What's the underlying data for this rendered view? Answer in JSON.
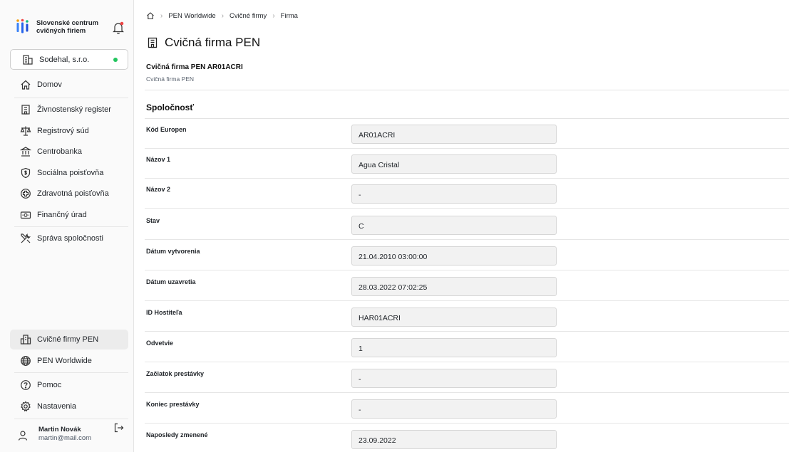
{
  "brand": {
    "name_line1": "Slovenské centrum",
    "name_line2": "cvičných firiem"
  },
  "org_switcher": {
    "label": "Sodehal, s.r.o.",
    "status_color": "#22c55e"
  },
  "nav_top": [
    {
      "label": "Domov",
      "icon": "home-icon"
    },
    {
      "label": "Živnostenský register",
      "icon": "building-icon"
    },
    {
      "label": "Registrový súd",
      "icon": "court-icon"
    },
    {
      "label": "Centrobanka",
      "icon": "bank-icon"
    },
    {
      "label": "Sociálna poisťovňa",
      "icon": "shield-dollar-icon"
    },
    {
      "label": "Zdravotná poisťovňa",
      "icon": "health-cross-icon"
    },
    {
      "label": "Finančný úrad",
      "icon": "cash-icon"
    },
    {
      "label": "Správa spoločnosti",
      "icon": "tools-icon"
    }
  ],
  "nav_bottom": [
    {
      "label": "Cvičné firmy PEN",
      "icon": "companies-icon",
      "active": true
    },
    {
      "label": "PEN Worldwide",
      "icon": "globe-icon"
    },
    {
      "label": "Pomoc",
      "icon": "help-icon"
    },
    {
      "label": "Nastavenia",
      "icon": "gear-icon"
    }
  ],
  "user": {
    "name": "Martin Novák",
    "email": "martin@mail.com"
  },
  "breadcrumb": [
    "PEN Worldwide",
    "Cvičné firmy",
    "Firma"
  ],
  "page": {
    "title": "Cvičná firma PEN",
    "subtitle": "Cvičná firma PEN AR01ACRI",
    "caption": "Cvičná firma PEN",
    "section_title": "Spoločnosť"
  },
  "fields": [
    {
      "label": "Kód Europen",
      "value": "AR01ACRI"
    },
    {
      "label": "Názov 1",
      "value": "Agua Cristal"
    },
    {
      "label": "Názov 2",
      "value": "-"
    },
    {
      "label": "Stav",
      "value": "C"
    },
    {
      "label": "Dátum vytvorenia",
      "value": "21.04.2010 03:00:00"
    },
    {
      "label": "Dátum uzavretia",
      "value": "28.03.2022 07:02:25"
    },
    {
      "label": "ID Hostiteľa",
      "value": "HAR01ACRI"
    },
    {
      "label": "Odvetvie",
      "value": "1"
    },
    {
      "label": "Začiatok prestávky",
      "value": "-"
    },
    {
      "label": "Koniec prestávky",
      "value": "-"
    },
    {
      "label": "Naposledy zmenené",
      "value": "23.09.2022"
    }
  ]
}
